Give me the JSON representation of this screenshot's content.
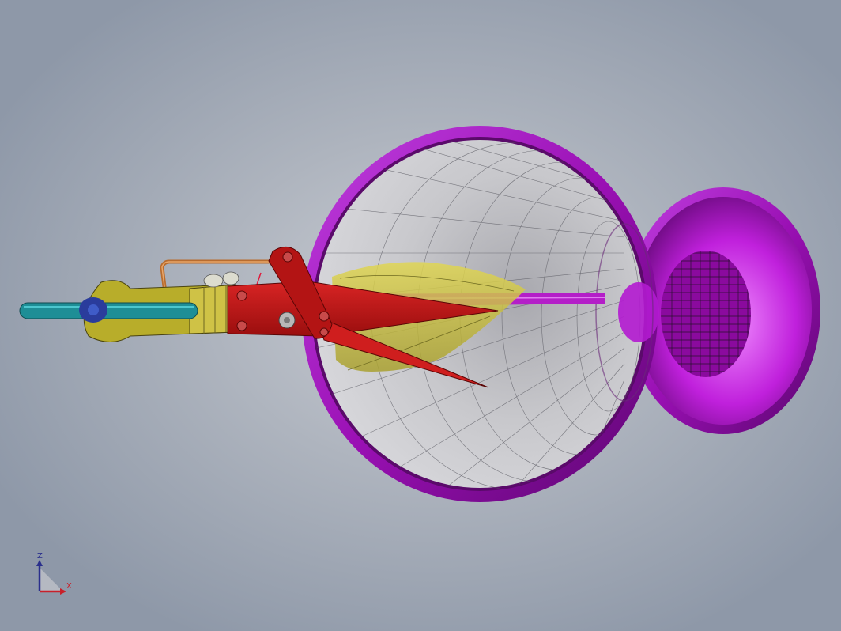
{
  "viewport": {
    "background_top": "#aeb4be",
    "background_center": "#c9ccd3"
  },
  "model": {
    "components": [
      {
        "name": "funnel-large",
        "color": "#a020c8"
      },
      {
        "name": "funnel-small-cup",
        "color": "#b012d4"
      },
      {
        "name": "cutter-blades",
        "color": "#c81818"
      },
      {
        "name": "leaf-body",
        "color": "#cfc43a"
      },
      {
        "name": "shaft",
        "color": "#b41ec8"
      },
      {
        "name": "handle-bracket",
        "color": "#b8ad2a"
      },
      {
        "name": "grip-rod",
        "color": "#1e8e96"
      },
      {
        "name": "copper-rod",
        "color": "#b86c2e"
      }
    ]
  },
  "triad": {
    "z_label": "Z",
    "x_label": "X",
    "z_color": "#2a2f8c",
    "x_color": "#c8202a"
  }
}
